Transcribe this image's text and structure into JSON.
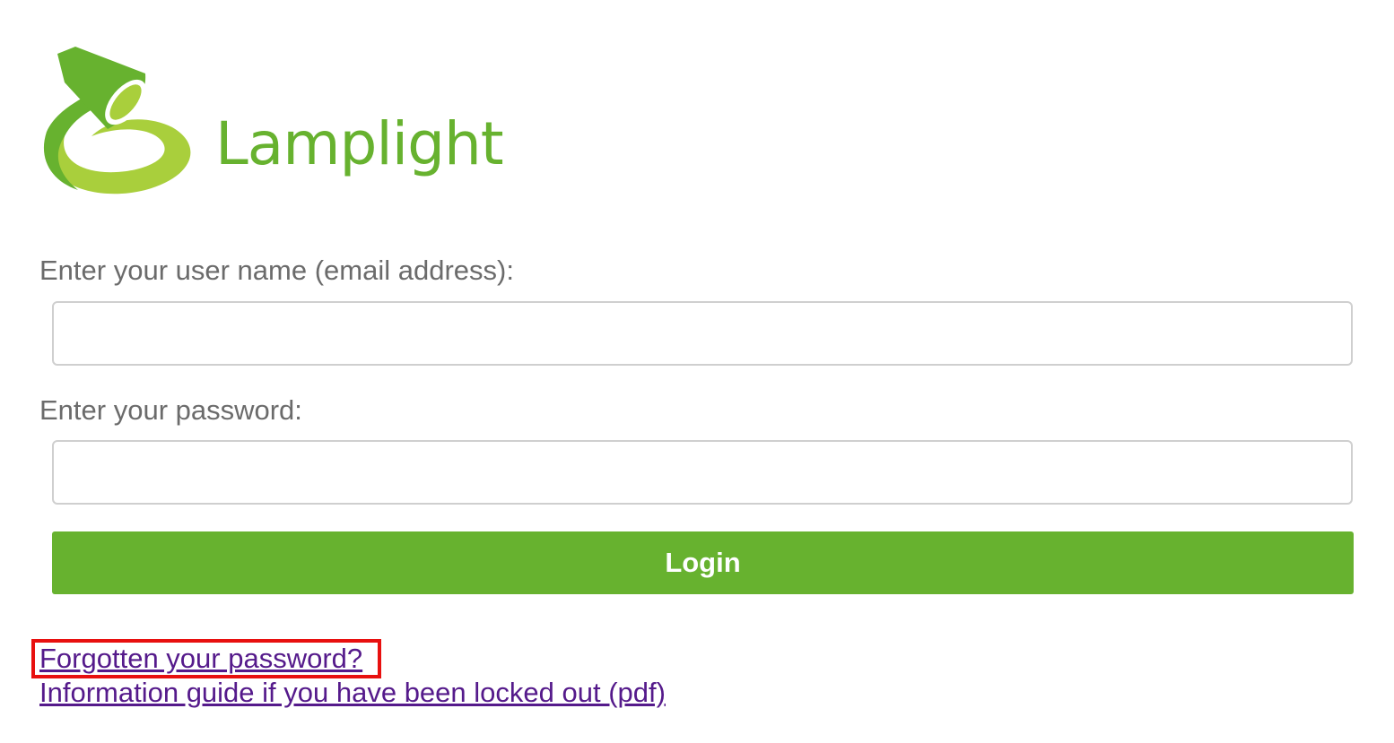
{
  "colors": {
    "brand_green": "#67b22f",
    "brand_green_light": "#a9cf3c",
    "button_green": "#67b22f",
    "link_purple": "#551a8b",
    "highlight_red": "#e8100f"
  },
  "logo": {
    "text": "Lamplight",
    "icon": "lamp-icon"
  },
  "form": {
    "username_label": "Enter your user name (email address):",
    "username_value": "",
    "password_label": "Enter your password:",
    "password_value": "",
    "login_label": "Login"
  },
  "links": {
    "forgot_password": "Forgotten your password?",
    "locked_out_guide": "Information guide if you have been locked out (pdf)"
  }
}
